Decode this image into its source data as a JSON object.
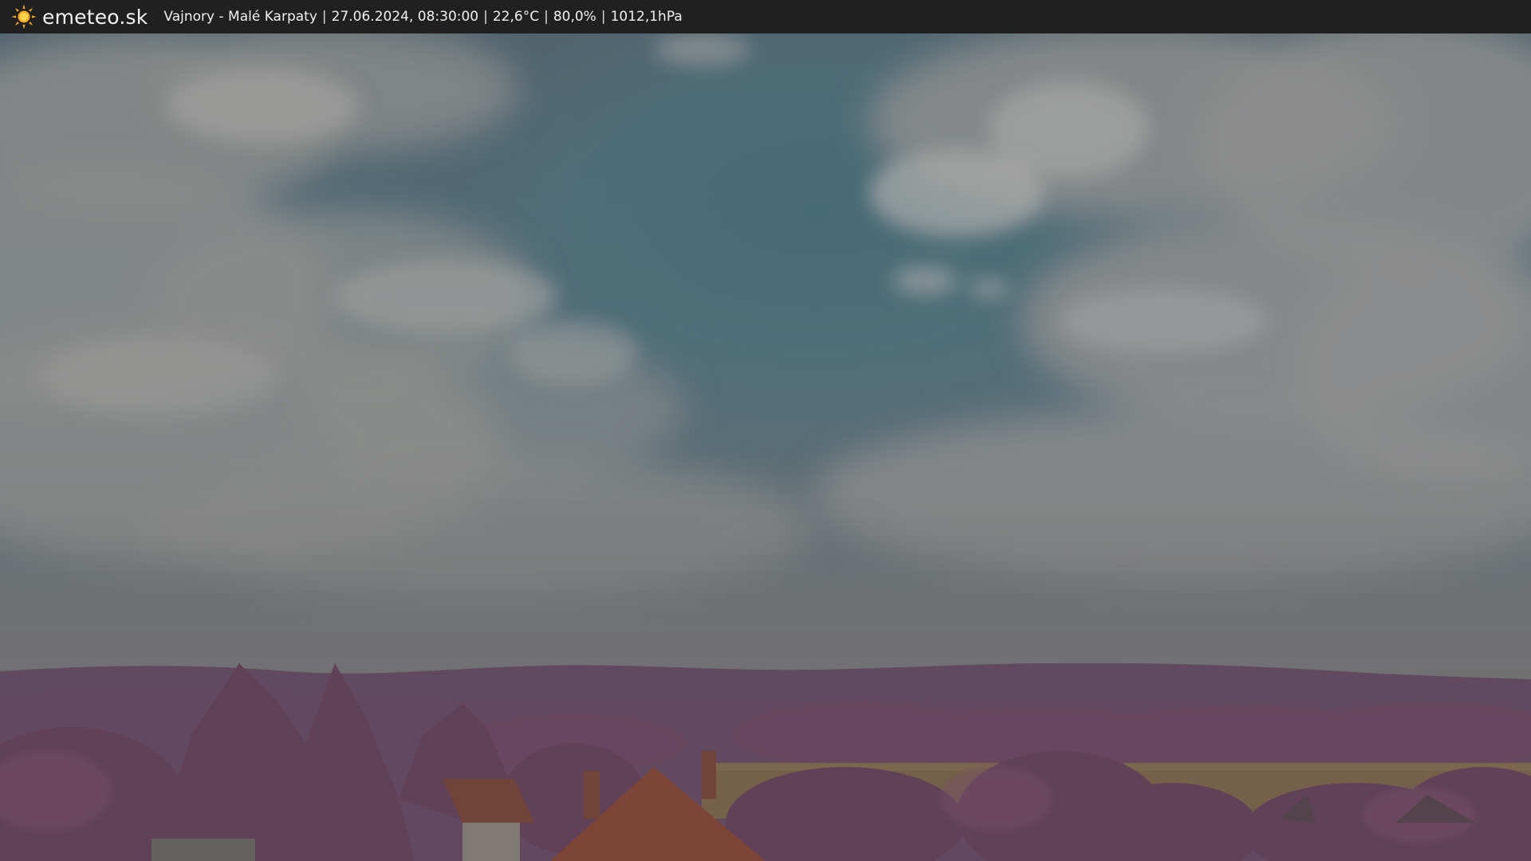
{
  "header": {
    "brand": "emeteo.sk",
    "brand_icon": "sun-icon",
    "location": "Vajnory - Malé Karpaty",
    "datetime": "27.06.2024, 08:30:00",
    "temperature": "22,6°C",
    "humidity": "80,0%",
    "pressure": "1012,1hPa",
    "separator": "|"
  },
  "colors": {
    "bar_bg": "#202020",
    "sun": "#f5a623",
    "sky": "#587886",
    "cloud": "#9a9a98",
    "foliage": "#7a5068",
    "roof": "#8a4a3a"
  }
}
